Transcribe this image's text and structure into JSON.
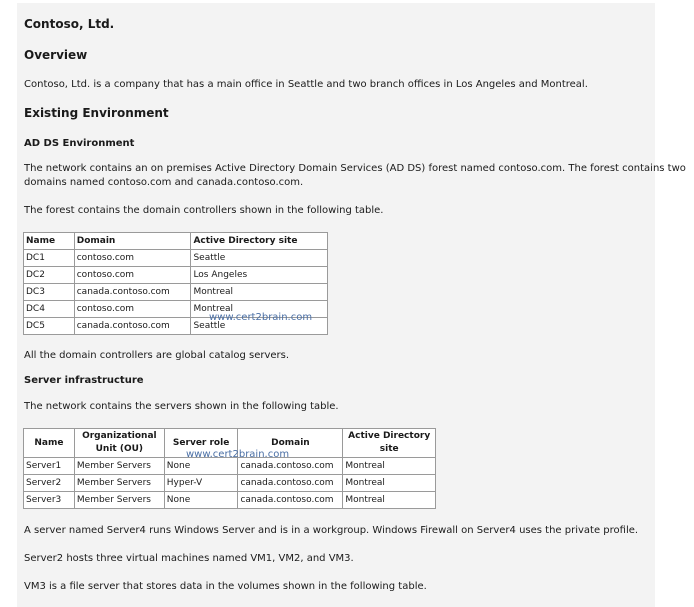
{
  "doc": {
    "title": "Contoso, Ltd.",
    "overview_heading": "Overview",
    "overview_text": "Contoso, Ltd. is a company that has a main office in Seattle and two branch offices in Los Angeles and Montreal.",
    "existing_heading": "Existing Environment",
    "adds_heading": "AD DS Environment",
    "adds_text_line1": "The network contains an on premises Active Directory Domain Services (AD DS) forest named contoso.com. The forest contains two",
    "adds_text_line2": "domains named contoso.com and canada.contoso.com.",
    "forest_text": "The forest contains the domain controllers shown in the following table.",
    "dc_headers": [
      "Name",
      "Domain",
      "Active Directory site"
    ],
    "dc_rows": [
      [
        "DC1",
        "contoso.com",
        "Seattle"
      ],
      [
        "DC2",
        "contoso.com",
        "Los Angeles"
      ],
      [
        "DC3",
        "canada.contoso.com",
        "Montreal"
      ],
      [
        "DC4",
        "contoso.com",
        "Montreal"
      ],
      [
        "DC5",
        "canada.contoso.com",
        "Seattle"
      ]
    ],
    "gc_text": "All the domain controllers are global catalog servers.",
    "server_heading": "Server infrastructure",
    "server_text": "The network contains the servers shown in the following table.",
    "srv_headers": [
      "Name",
      "Organizational Unit (OU)",
      "Server role",
      "Domain",
      "Active Directory site"
    ],
    "srv_rows": [
      [
        "Server1",
        "Member Servers",
        "None",
        "canada.contoso.com",
        "Montreal"
      ],
      [
        "Server2",
        "Member Servers",
        "Hyper-V",
        "canada.contoso.com",
        "Montreal"
      ],
      [
        "Server3",
        "Member Servers",
        "None",
        "canada.contoso.com",
        "Montreal"
      ]
    ],
    "server4_text": "A server named Server4 runs Windows Server and is in a workgroup. Windows Firewall on Server4 uses the private profile.",
    "server2_text": "Server2 hosts three virtual machines named VM1, VM2, and VM3.",
    "vm3_text": "VM3 is a file server that stores data in the volumes shown in the following table.",
    "watermark": "www.cert2brain.com"
  }
}
